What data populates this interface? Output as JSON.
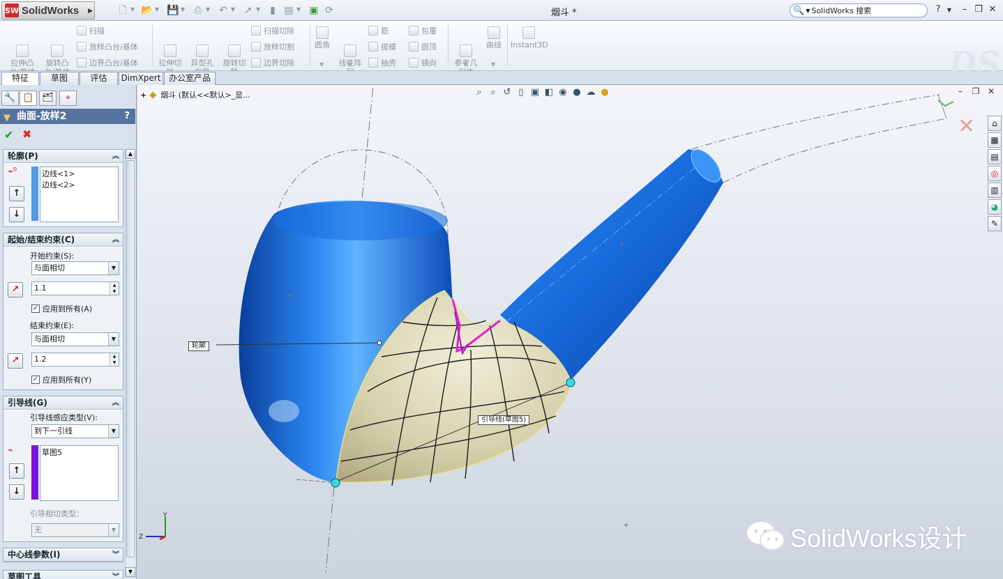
{
  "app": {
    "brand": "SolidWorks",
    "doc_title": "烟斗 *",
    "search_placeholder": "SolidWorks 搜索"
  },
  "window_controls": {
    "help": "?",
    "minimize": "–",
    "restore": "❐",
    "close": "✕"
  },
  "commands": {
    "extrude_boss": "拉伸凸\n台/基体",
    "revolve_boss": "旋转凸\n台/基体",
    "sweep": "扫描",
    "loft_boss": "放样凸台/基体",
    "boundary_boss": "边界凸台/基体",
    "extrude_cut": "拉伸切\n除",
    "hole_wizard": "异型孔\n向导",
    "revolve_cut": "旋转切\n除",
    "sweep_cut": "扫描切除",
    "loft_cut": "放样切割",
    "boundary_cut": "边界切除",
    "fillet": "圆角",
    "linear_pattern": "线性阵\n列",
    "rib": "筋",
    "draft": "拔模",
    "shell": "抽壳",
    "wrap": "包覆",
    "dome": "圆顶",
    "mirror": "镜向",
    "ref_geometry": "参考几\n何体",
    "curves": "曲线",
    "instant3d": "Instant3D"
  },
  "tabs": [
    "特征",
    "草图",
    "评估",
    "DimXpert",
    "办公室产品"
  ],
  "property_manager": {
    "title": "曲面-放样2",
    "help": "?",
    "profile": {
      "header": "轮廓(P)",
      "items": [
        "边线<1>",
        "边线<2>"
      ],
      "color": "#4f9be6"
    },
    "constraints": {
      "header": "起始/结束约束(C)",
      "start_label": "开始约束(S):",
      "start_value": "与面相切",
      "start_tangent_length": "1.1",
      "apply_all_1": "应用到所有(A)",
      "end_label": "结束约束(E):",
      "end_value": "与面相切",
      "end_tangent_length": "1.2",
      "apply_all_2": "应用到所有(Y)"
    },
    "guides": {
      "header": "引导线(G)",
      "influence_label": "引导线感应类型(V):",
      "influence_value": "到下一引线",
      "items": [
        "草图5"
      ],
      "color": "#7b12e0",
      "tangency_label": "引导相切类型：",
      "tangency_value": "无"
    },
    "centerline": {
      "header": "中心线参数(I)"
    },
    "sketch_tools": {
      "header": "草图工具"
    }
  },
  "viewport": {
    "tree_label": "烟斗  (默认<<默认>_显...",
    "callout_profile": "轮廓",
    "callout_guide": "引导线(草图5)",
    "triad_y": "Y",
    "triad_z": "Z",
    "watermark": "SolidWorks设计"
  },
  "colors": {
    "model_blue": "#1f6fe0",
    "surface_tan": "#cfcaa6",
    "guide_magenta": "#e020d0",
    "accent_title": "#5673a0"
  }
}
